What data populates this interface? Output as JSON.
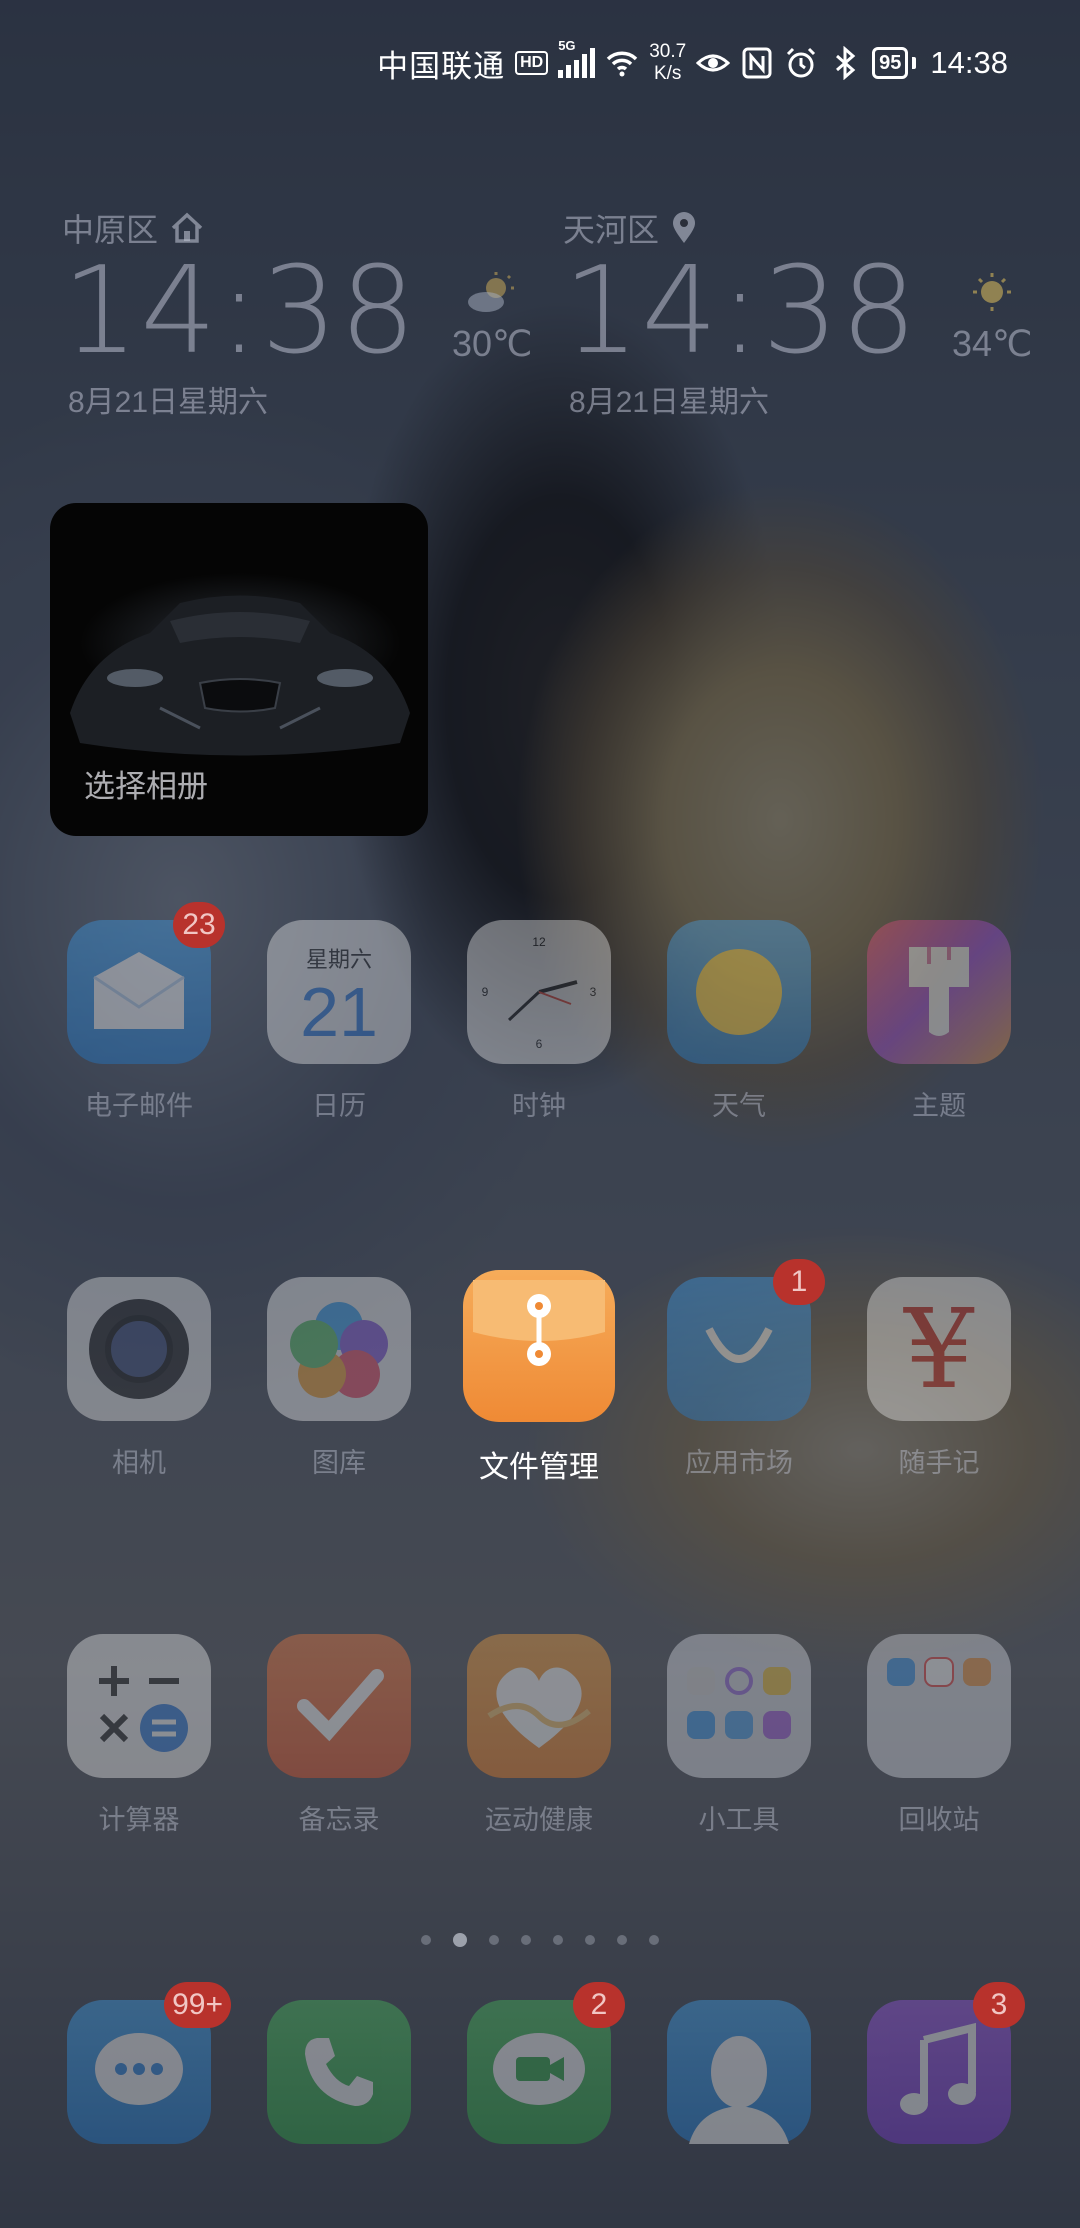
{
  "status_bar": {
    "carrier": "中国联通",
    "hd": "HD",
    "network": "5G",
    "speed_value": "30.7",
    "speed_unit": "K/s",
    "battery": "95",
    "time": "14:38"
  },
  "clocks": [
    {
      "city": "中原区",
      "city_icon": "home-icon",
      "time": "14:38",
      "date": "8月21日星期六",
      "temp": "30℃",
      "weather_icon": "partly-cloudy-icon"
    },
    {
      "city": "天河区",
      "city_icon": "location-pin-icon",
      "time": "14:38",
      "date": "8月21日星期六",
      "temp": "34℃",
      "weather_icon": "sunny-icon"
    }
  ],
  "photo_widget": {
    "label": "选择相册"
  },
  "apps": {
    "row1": [
      {
        "label": "电子邮件",
        "badge": "23"
      },
      {
        "label": "日历",
        "weekday": "星期六",
        "day": "21"
      },
      {
        "label": "时钟",
        "n12": "12",
        "n3": "3",
        "n6": "6",
        "n9": "9"
      },
      {
        "label": "天气"
      },
      {
        "label": "主题"
      }
    ],
    "row2": [
      {
        "label": "相机"
      },
      {
        "label": "图库"
      },
      {
        "label": "文件管理"
      },
      {
        "label": "应用市场",
        "badge": "1"
      },
      {
        "label": "随手记",
        "glyph": "¥"
      }
    ],
    "row3": [
      {
        "label": "计算器"
      },
      {
        "label": "备忘录"
      },
      {
        "label": "运动健康"
      },
      {
        "label": "小工具"
      },
      {
        "label": "回收站"
      }
    ],
    "dock": [
      {
        "name": "messages",
        "badge": "99+"
      },
      {
        "name": "phone"
      },
      {
        "name": "meetime",
        "badge": "2"
      },
      {
        "name": "contacts"
      },
      {
        "name": "music",
        "badge": "3"
      }
    ]
  },
  "page_indicator": {
    "count": 8,
    "active_index": 1
  },
  "colors": {
    "dim_overlay": "#0c101c",
    "badge": "#b8322c",
    "files_orange": "#f39a45"
  }
}
